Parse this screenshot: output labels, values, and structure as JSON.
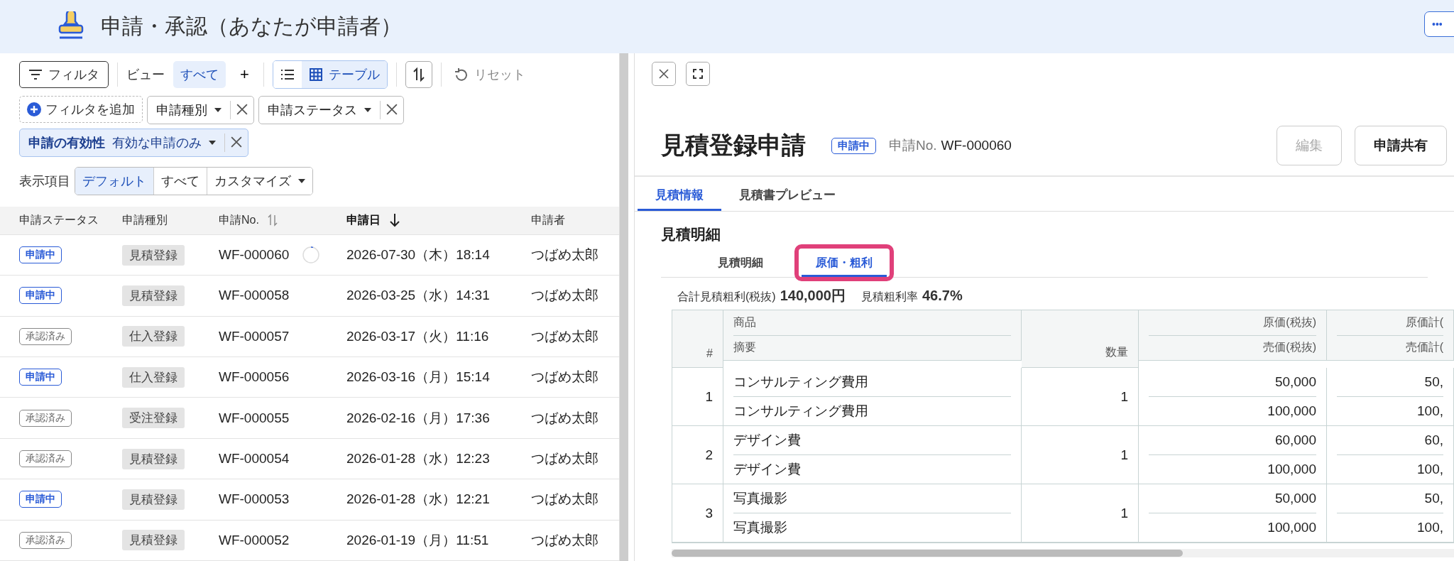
{
  "header": {
    "title": "申請・承認（あなたが申請者）",
    "more_button": "•••"
  },
  "toolbar": {
    "filter_button": "フィルタ",
    "view_label": "ビュー",
    "views": [
      {
        "label": "すべて",
        "selected": true
      }
    ],
    "add_view": "+",
    "view_modes": [
      {
        "kind": "list",
        "selected": false
      },
      {
        "kind": "table",
        "label": "テーブル",
        "selected": true
      }
    ],
    "reset": "リセット"
  },
  "filters": {
    "add_filter": "フィルタを追加",
    "chips": [
      {
        "label": "申請種別",
        "active": false
      },
      {
        "label": "申請ステータス",
        "active": false
      },
      {
        "label": "申請の有効性",
        "value": "有効な申請のみ",
        "active": true
      }
    ]
  },
  "display": {
    "label": "表示項目",
    "options": [
      {
        "label": "デフォルト",
        "selected": true,
        "dropdown": false
      },
      {
        "label": "すべて",
        "selected": false,
        "dropdown": false
      },
      {
        "label": "カスタマイズ",
        "selected": false,
        "dropdown": true
      }
    ]
  },
  "list": {
    "columns": [
      {
        "label": "申請ステータス"
      },
      {
        "label": "申請種別"
      },
      {
        "label": "申請No.",
        "kind": "sortable"
      },
      {
        "label": "申請日",
        "kind": "sorted"
      },
      {
        "label": "申請者"
      }
    ],
    "rows": [
      {
        "status": "申請中",
        "kind": "pending",
        "type": "見積登録",
        "no": "WF-000060",
        "loading": true,
        "date": "2026-07-30（木）18:14",
        "applicant": "つばめ太郎"
      },
      {
        "status": "申請中",
        "kind": "pending",
        "type": "見積登録",
        "no": "WF-000058",
        "loading": false,
        "date": "2026-03-25（水）14:31",
        "applicant": "つばめ太郎"
      },
      {
        "status": "承認済み",
        "kind": "approved",
        "type": "仕入登録",
        "no": "WF-000057",
        "loading": false,
        "date": "2026-03-17（火）11:16",
        "applicant": "つばめ太郎"
      },
      {
        "status": "申請中",
        "kind": "pending",
        "type": "仕入登録",
        "no": "WF-000056",
        "loading": false,
        "date": "2026-03-16（月）15:14",
        "applicant": "つばめ太郎"
      },
      {
        "status": "承認済み",
        "kind": "approved",
        "type": "受注登録",
        "no": "WF-000055",
        "loading": false,
        "date": "2026-02-16（月）17:36",
        "applicant": "つばめ太郎"
      },
      {
        "status": "承認済み",
        "kind": "approved",
        "type": "見積登録",
        "no": "WF-000054",
        "loading": false,
        "date": "2026-01-28（水）12:23",
        "applicant": "つばめ太郎"
      },
      {
        "status": "申請中",
        "kind": "pending",
        "type": "見積登録",
        "no": "WF-000053",
        "loading": false,
        "date": "2026-01-28（水）12:21",
        "applicant": "つばめ太郎"
      },
      {
        "status": "承認済み",
        "kind": "approved",
        "type": "見積登録",
        "no": "WF-000052",
        "loading": false,
        "date": "2026-01-19（月）11:51",
        "applicant": "つばめ太郎"
      }
    ]
  },
  "detail": {
    "title": "見積登録申請",
    "status": "申請中",
    "no_label": "申請No.",
    "no": "WF-000060",
    "buttons": [
      {
        "label": "編集",
        "disabled": true
      },
      {
        "label": "申請共有",
        "disabled": false
      }
    ],
    "tabs": [
      {
        "label": "見積情報",
        "selected": true
      },
      {
        "label": "見積書プレビュー",
        "selected": false
      }
    ],
    "section_title": "見積明細",
    "sub_tabs": [
      {
        "label": "見積明細",
        "selected": false,
        "highlighted": false
      },
      {
        "label": "原価・粗利",
        "selected": true,
        "highlighted": true
      }
    ],
    "summary": [
      {
        "label": "合計見積粗利(税抜)",
        "value": "140,000円"
      },
      {
        "label": "見積粗利率",
        "value": "46.7%"
      }
    ],
    "table": {
      "columns": [
        {
          "bottom": "#",
          "kind": "numeric"
        },
        {
          "top": "商品",
          "bottom": "摘要",
          "kind": "text"
        },
        {
          "bottom": "数量",
          "kind": "numeric"
        },
        {
          "top": "原価(税抜)",
          "bottom": "売価(税抜)",
          "kind": "numeric"
        },
        {
          "top": "原価計(",
          "bottom": "売価計(",
          "kind": "numeric"
        }
      ],
      "rows": [
        {
          "no": "1",
          "product": "コンサルティング費用",
          "summary": "コンサルティング費用",
          "qty": "1",
          "cost": "50,000",
          "price": "100,000",
          "cost_total": "50,",
          "price_total": "100,"
        },
        {
          "no": "2",
          "product": "デザイン費",
          "summary": "デザイン費",
          "qty": "1",
          "cost": "60,000",
          "price": "100,000",
          "cost_total": "60,",
          "price_total": "100,"
        },
        {
          "no": "3",
          "product": "写真撮影",
          "summary": "写真撮影",
          "qty": "1",
          "cost": "50,000",
          "price": "100,000",
          "cost_total": "50,",
          "price_total": "100,"
        }
      ]
    }
  }
}
